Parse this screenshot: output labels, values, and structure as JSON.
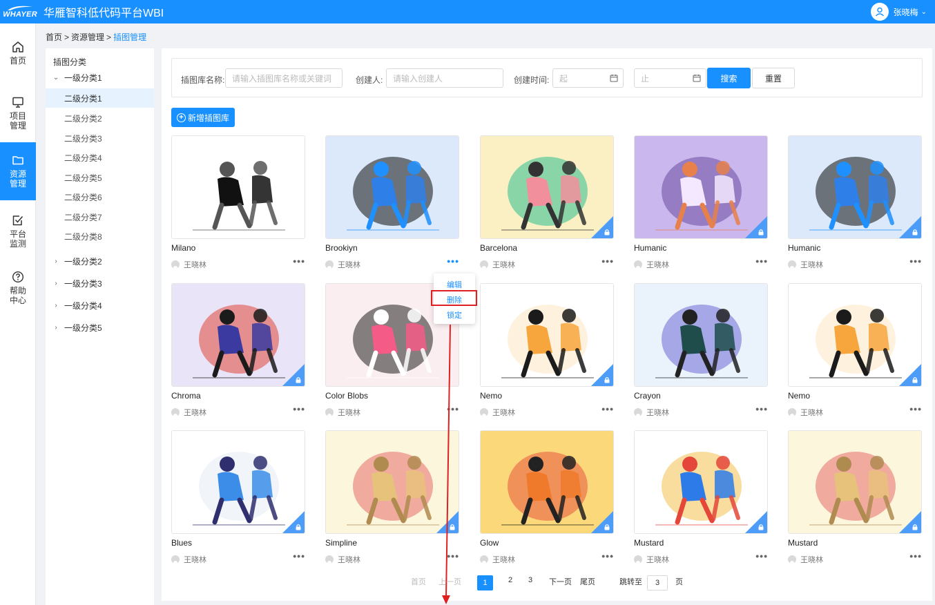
{
  "app": {
    "logo_text": "WHAYER",
    "title": "华雁智科低代码平台WBI",
    "user_name": "张晓梅"
  },
  "nav": [
    {
      "label": "首页",
      "icon": "home-icon"
    },
    {
      "label": "项目管理",
      "icon": "monitor-icon"
    },
    {
      "label": "资源管理",
      "icon": "folder-icon",
      "active": true
    },
    {
      "label": "平台监测",
      "icon": "checkbox-icon"
    },
    {
      "label": "帮助中心",
      "icon": "help-icon"
    }
  ],
  "breadcrumb": {
    "items": [
      "首页",
      "资源管理"
    ],
    "separator": ">",
    "current": "插图管理"
  },
  "tree": {
    "title": "插图分类",
    "first_level": [
      "一级分类1",
      "一级分类2",
      "一级分类3",
      "一级分类4",
      "一级分类5"
    ],
    "children": [
      "二级分类1",
      "二级分类2",
      "二级分类3",
      "二级分类4",
      "二级分类5",
      "二级分类6",
      "二级分类7",
      "二级分类8"
    ]
  },
  "filter": {
    "name_label": "插图库名称:",
    "name_placeholder": "请输入插图库名称或关键词",
    "creator_label": "创建人:",
    "creator_placeholder": "请输入创建人",
    "time_label": "创建时间:",
    "start_placeholder": "起",
    "end_placeholder": "止",
    "dash": "-",
    "search_label": "搜索",
    "reset_label": "重置"
  },
  "add_button": "新增插图库",
  "cards": [
    {
      "title": "Milano",
      "user": "王晓林",
      "locked": false
    },
    {
      "title": "Brookiyn",
      "user": "王晓林",
      "locked": false,
      "menu_open": true
    },
    {
      "title": "Barcelona",
      "user": "王晓林",
      "locked": true
    },
    {
      "title": "Humanic",
      "user": "王晓林",
      "locked": true
    },
    {
      "title": "Humanic",
      "user": "王晓林",
      "locked": true
    },
    {
      "title": "Chroma",
      "user": "王晓林",
      "locked": true
    },
    {
      "title": "Color Blobs",
      "user": "王晓林",
      "locked": false
    },
    {
      "title": "Nemo",
      "user": "王晓林",
      "locked": true
    },
    {
      "title": "Crayon",
      "user": "王晓林",
      "locked": false
    },
    {
      "title": "Nemo",
      "user": "王晓林",
      "locked": true
    },
    {
      "title": "Blues",
      "user": "王晓林",
      "locked": true
    },
    {
      "title": "Simpline",
      "user": "王晓林",
      "locked": true
    },
    {
      "title": "Glow",
      "user": "王晓林",
      "locked": true
    },
    {
      "title": "Mustard",
      "user": "王晓林",
      "locked": true
    },
    {
      "title": "Mustard",
      "user": "王晓林",
      "locked": true
    }
  ],
  "more_glyph": "•••",
  "card_menu": {
    "items": [
      "编辑",
      "删除",
      "锁定"
    ],
    "highlighted": "删除"
  },
  "pagination": {
    "first": "首页",
    "prev": "上一页",
    "pages": [
      "1",
      "2",
      "3"
    ],
    "current": "1",
    "next": "下一页",
    "last": "尾页",
    "jump_label": "跳转至",
    "jump_value": "3",
    "page_unit": "页"
  },
  "colors": {
    "primary": "#1890ff",
    "annotation": "#e02020"
  }
}
